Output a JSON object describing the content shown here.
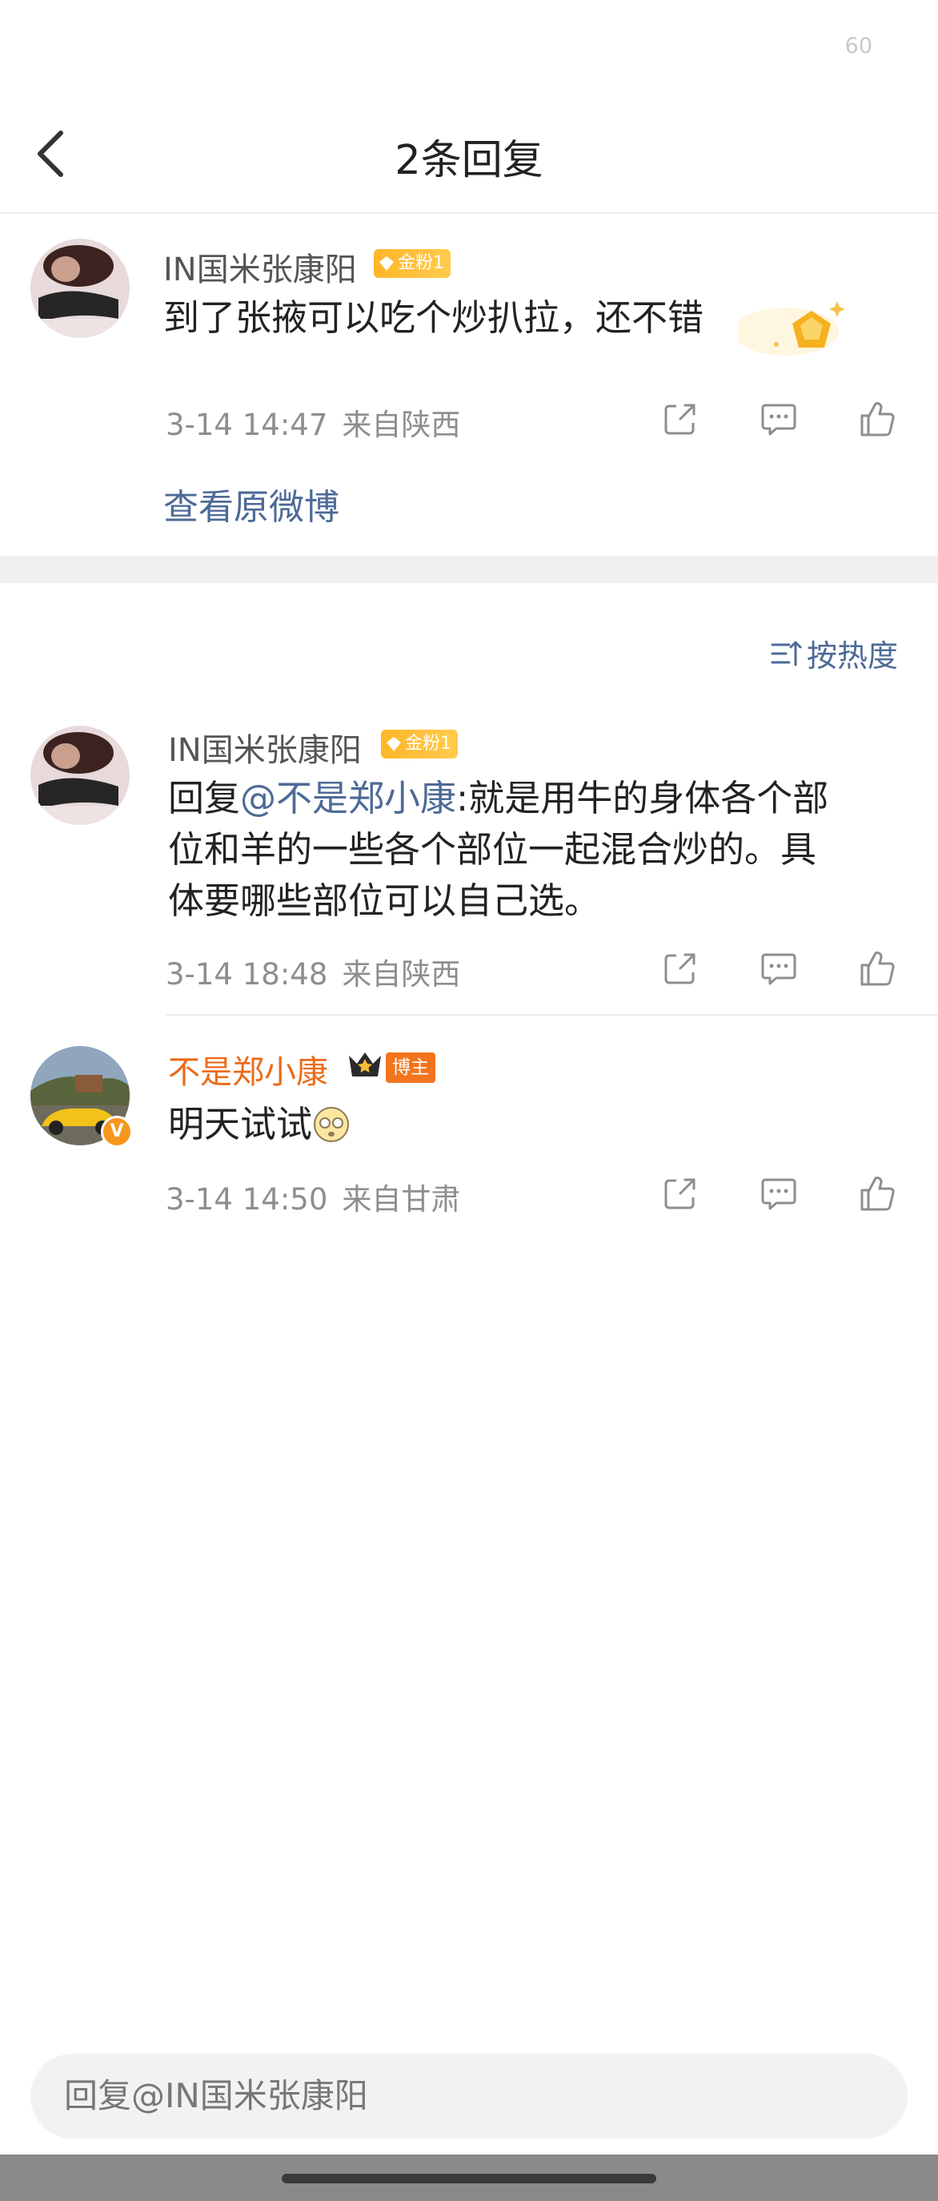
{
  "status_bar": {
    "number": "60"
  },
  "nav": {
    "title": "2条回复"
  },
  "root_comment": {
    "username": "IN国米张康阳",
    "fan_badge": "金粉1",
    "text": "到了张掖可以吃个炒扒拉，还不错",
    "time": "3-14 14:47",
    "location": "来自陕西",
    "view_original": "查看原微博"
  },
  "sort": {
    "label": "按热度"
  },
  "replies": [
    {
      "username": "IN国米张康阳",
      "fan_badge": "金粉1",
      "reply_prefix": "回复",
      "mention": "@不是郑小康",
      "text_line1": ":就是用牛的身体各个部",
      "text_line2": "位和羊的一些各个部位一起混合炒的。具",
      "text_line3": "体要哪些部位可以自己选。",
      "time": "3-14 18:48",
      "location": "来自陕西"
    },
    {
      "username": "不是郑小康",
      "host_badge": "博主",
      "verified_mark": "V",
      "text": "明天试试",
      "emoji": "yawn-emoji",
      "time": "3-14 14:50",
      "location": "来自甘肃"
    }
  ],
  "reply_box": {
    "placeholder": "回复@IN国米张康阳"
  },
  "colors": {
    "link": "#4d6a96",
    "host_name": "#eb6b19",
    "fan_badge": "#ffb629",
    "host_badge": "#f3741d"
  }
}
